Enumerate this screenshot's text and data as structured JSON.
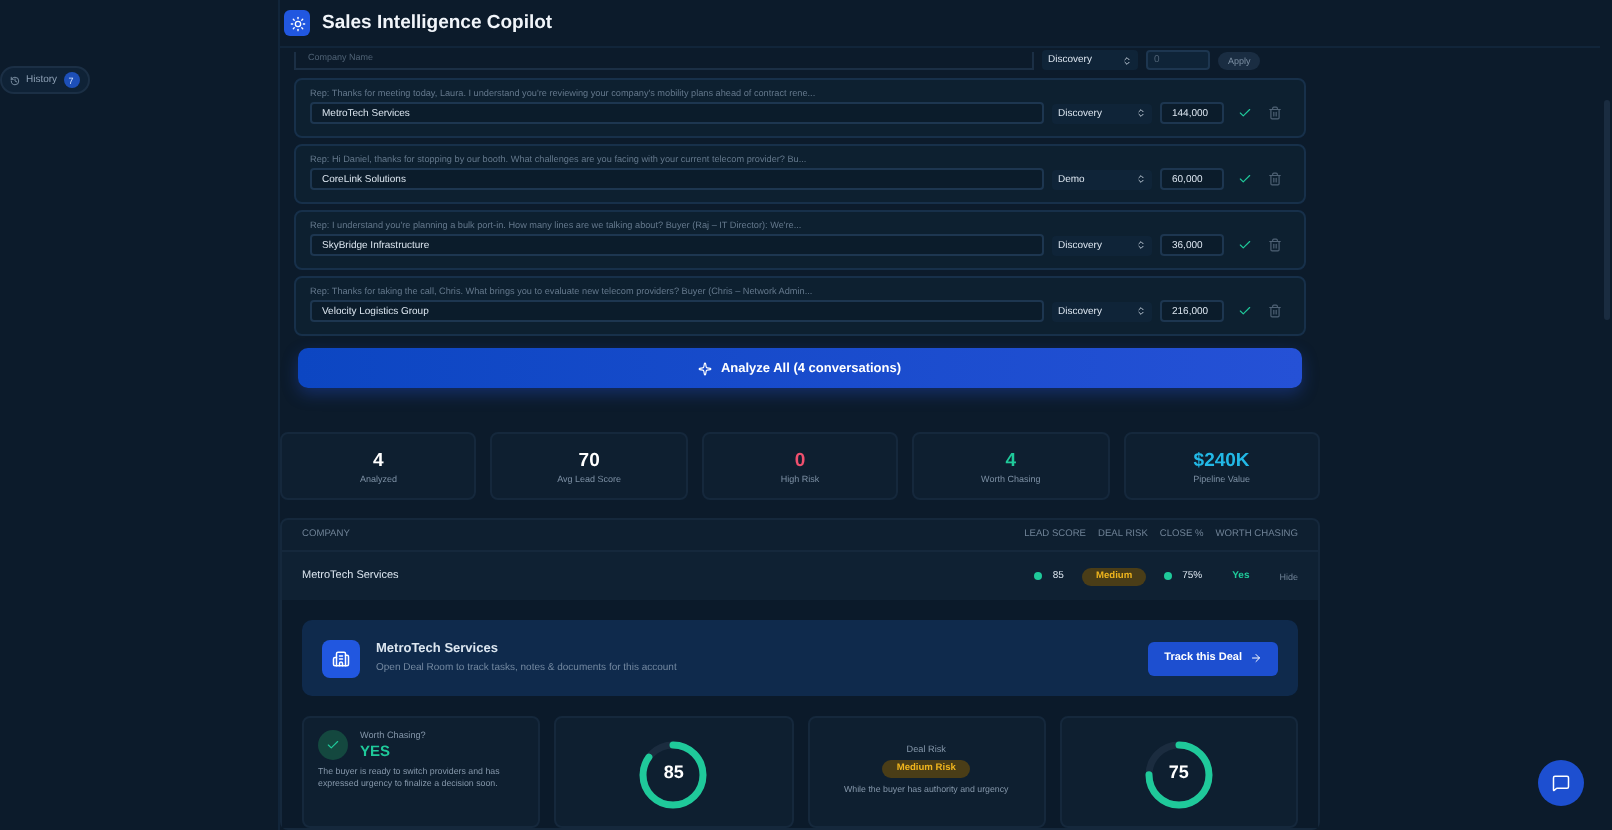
{
  "header": {
    "title": "Sales Intelligence Copilot"
  },
  "sidebar": {
    "history": {
      "label": "History",
      "count": "7"
    }
  },
  "new_entry": {
    "company_placeholder": "Company Name",
    "stage": "Discovery",
    "amount_placeholder": "0",
    "apply": "Apply"
  },
  "conversations": [
    {
      "transcript": "Rep: Thanks for meeting today, Laura. I understand you're reviewing your company's mobility plans ahead of contract rene...",
      "company": "MetroTech Services",
      "stage": "Discovery",
      "amount": "144,000"
    },
    {
      "transcript": "Rep: Hi Daniel, thanks for stopping by our booth. What challenges are you facing with your current telecom provider? Bu...",
      "company": "CoreLink Solutions",
      "stage": "Demo",
      "amount": "60,000"
    },
    {
      "transcript": "Rep: I understand you're planning a bulk port-in. How many lines are we talking about? Buyer (Raj – IT Director): We're...",
      "company": "SkyBridge Infrastructure",
      "stage": "Discovery",
      "amount": "36,000"
    },
    {
      "transcript": "Rep: Thanks for taking the call, Chris. What brings you to evaluate new telecom providers? Buyer (Chris – Network Admin...",
      "company": "Velocity Logistics Group",
      "stage": "Discovery",
      "amount": "216,000"
    }
  ],
  "analyze_button": "Analyze All (4 conversations)",
  "stats": [
    {
      "value": "4",
      "label": "Analyzed",
      "color": "#ffffff"
    },
    {
      "value": "70",
      "label": "Avg Lead Score",
      "color": "#ffffff"
    },
    {
      "value": "0",
      "label": "High Risk",
      "color": "#f0506e"
    },
    {
      "value": "4",
      "label": "Worth Chasing",
      "color": "#1fc99a"
    },
    {
      "value": "$240K",
      "label": "Pipeline Value",
      "color": "#22b8e6"
    }
  ],
  "table": {
    "columns": [
      "COMPANY",
      "LEAD SCORE",
      "DEAL RISK",
      "CLOSE %",
      "WORTH CHASING"
    ],
    "rows": [
      {
        "company": "MetroTech Services",
        "lead_score": "85",
        "deal_risk": "Medium",
        "close": "75%",
        "worth_chasing": "Yes",
        "action": "Hide"
      }
    ]
  },
  "deal_room": {
    "title": "MetroTech Services",
    "subtitle": "Open Deal Room to track tasks, notes & documents for this account",
    "button": "Track this Deal"
  },
  "worth_card": {
    "label": "Worth Chasing?",
    "verdict": "YES",
    "text": "The buyer is ready to switch providers and has expressed urgency to finalize a decision soon."
  },
  "lead_ring": {
    "value": "85",
    "level": 0.85
  },
  "risk_card": {
    "label": "Deal Risk",
    "badge": "Medium Risk",
    "text": "While the buyer has authority and urgency"
  },
  "close_ring": {
    "value": "75",
    "level": 0.75
  }
}
